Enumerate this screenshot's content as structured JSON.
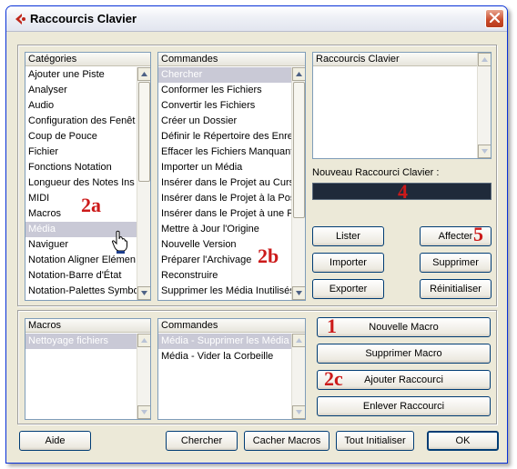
{
  "window": {
    "title": "Raccourcis Clavier"
  },
  "categories": {
    "header": "Catégories",
    "items": [
      "Ajouter une Piste",
      "Analyser",
      "Audio",
      "Configuration des Fenêt",
      "Coup de Pouce",
      "Fichier",
      "Fonctions Notation",
      "Longueur des Notes Ins",
      "MIDI",
      "Macros",
      "Média",
      "Naviguer",
      "Notation Aligner Elémen",
      "Notation-Barre d'État",
      "Notation-Palettes Symbo"
    ],
    "selected": "Média"
  },
  "commands": {
    "header": "Commandes",
    "items": [
      "Chercher",
      "Conformer les Fichiers",
      "Convertir les Fichiers",
      "Créer un Dossier",
      "Définir le Répertoire des Enreg",
      "Effacer les Fichiers Manquants",
      "Importer un Média",
      "Insérer dans le Projet au Curse",
      "Insérer dans le Projet à la Posi",
      "Insérer dans le Projet à une Po",
      "Mettre à Jour l'Origine",
      "Nouvelle Version",
      "Préparer l'Archivage",
      "Reconstruire",
      "Supprimer les Média Inutilisés"
    ],
    "selected": "Chercher"
  },
  "shortcuts": {
    "header": "Raccourcis Clavier",
    "new_label": "Nouveau Raccourci Clavier :",
    "new_value": ""
  },
  "buttons": {
    "lister": "Lister",
    "affecter": "Affecter",
    "importer": "Importer",
    "supprimer": "Supprimer",
    "exporter": "Exporter",
    "reinitialiser": "Réinitialiser",
    "nouvelle_macro": "Nouvelle Macro",
    "supprimer_macro": "Supprimer Macro",
    "ajouter_raccourci": "Ajouter Raccourci",
    "enlever_raccourci": "Enlever Raccourci",
    "aide": "Aide",
    "chercher": "Chercher",
    "cacher_macros": "Cacher Macros",
    "tout_initialiser": "Tout Initialiser",
    "ok": "OK"
  },
  "macros": {
    "header": "Macros",
    "items": [
      "Nettoyage fichiers"
    ],
    "selected": "Nettoyage fichiers"
  },
  "macro_commands": {
    "header": "Commandes",
    "items": [
      "Média - Supprimer les Média Ina",
      "Média - Vider la Corbeille"
    ],
    "selected": "Média - Supprimer les Média Ina"
  },
  "annotations": {
    "a1": "2a",
    "a2": "2b",
    "a3": "4",
    "a4": "5",
    "a5": "1",
    "a6": "2c"
  },
  "colors": {
    "accent_red": "#cc1a1a",
    "selection": "#c9c9d6",
    "window_bg": "#ece9d8",
    "xp_blue_border": "#003c74"
  }
}
